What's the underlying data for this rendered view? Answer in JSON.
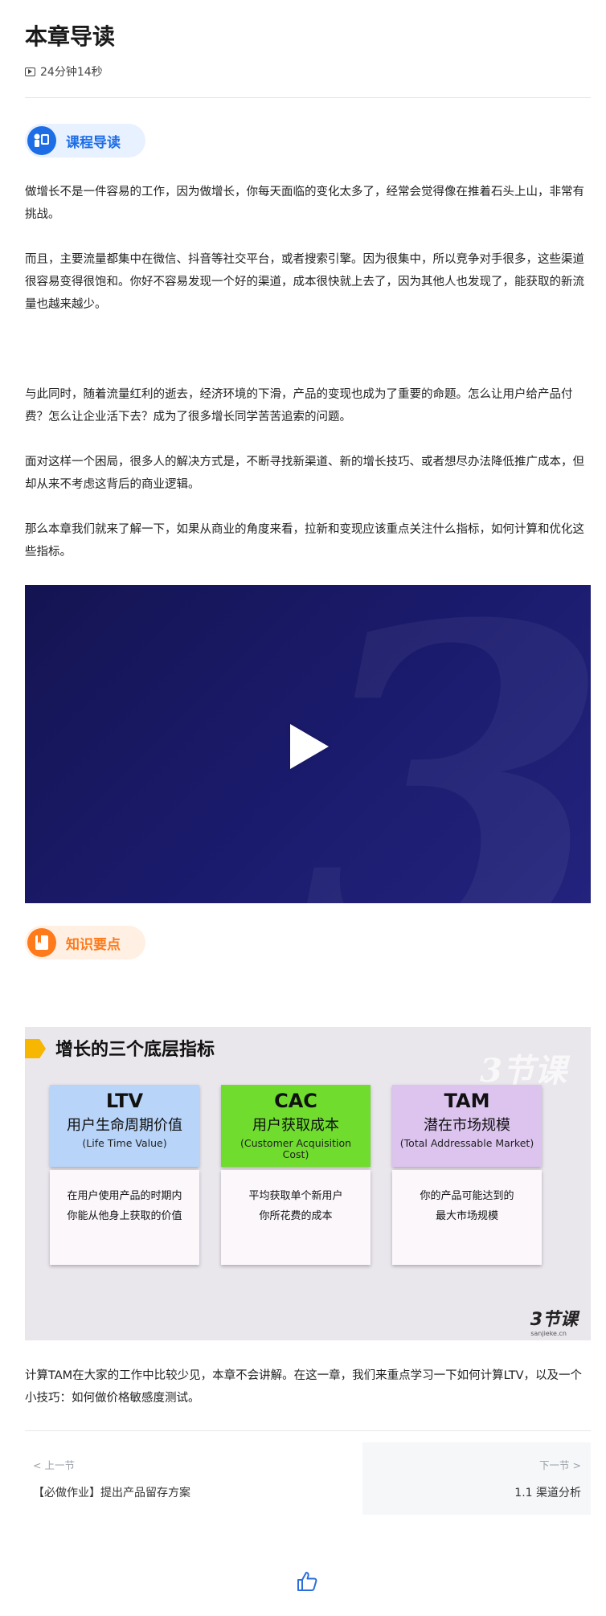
{
  "header": {
    "title": "本章导读",
    "duration": "24分钟14秒"
  },
  "section_intro": {
    "label": "课程导读"
  },
  "paragraphs": {
    "p1": "做增长不是一件容易的工作，因为做增长，你每天面临的变化太多了，经常会觉得像在推着石头上山，非常有挑战。",
    "p2": "而且，主要流量都集中在微信、抖音等社交平台，或者搜索引擎。因为很集中，所以竞争对手很多，这些渠道很容易变得很饱和。你好不容易发现一个好的渠道，成本很快就上去了，因为其他人也发现了，能获取的新流量也越来越少。",
    "p3": "与此同时，随着流量红利的逝去，经济环境的下滑，产品的变现也成为了重要的命题。怎么让用户给产品付费？怎么让企业活下去？成为了很多增长同学苦苦追索的问题。",
    "p4": "面对这样一个困局，很多人的解决方式是，不断寻找新渠道、新的增长技巧、或者想尽办法降低推广成本，但却从来不考虑这背后的商业逻辑。",
    "p5": "那么本章我们就来了解一下，如果从商业的角度来看，拉新和变现应该重点关注什么指标，如何计算和优化这些指标。",
    "p6": "计算TAM在大家的工作中比较少见，本章不会讲解。在这一章，我们来重点学习一下如何计算LTV，以及一个小技巧：如何做价格敏感度测试。"
  },
  "section_points": {
    "label": "知识要点"
  },
  "slide": {
    "title": "增长的三个底层指标",
    "watermark": "3节课",
    "brand": "3节课",
    "brand_sub": "sanjieke.cn",
    "cards": [
      {
        "abbr": "LTV",
        "cn": "用户生命周期价值",
        "en": "(Life Time Value)",
        "desc1": "在用户使用产品的时期内",
        "desc2": "你能从他身上获取的价值",
        "color": "#b8d4f8"
      },
      {
        "abbr": "CAC",
        "cn": "用户获取成本",
        "en": "(Customer Acquisition Cost)",
        "desc1": "平均获取单个新用户",
        "desc2": "你所花费的成本",
        "color": "#6fdc2e"
      },
      {
        "abbr": "TAM",
        "cn": "潜在市场规模",
        "en": "(Total Addressable Market)",
        "desc1": "你的产品可能达到的",
        "desc2": "最大市场规模",
        "color": "#dcc4ee"
      }
    ]
  },
  "nav": {
    "prev_label": "< 上一节",
    "prev_title": "【必做作业】提出产品留存方案",
    "next_label": "下一节 >",
    "next_title": "1.1 渠道分析"
  },
  "colors": {
    "accent_blue": "#1d6de6",
    "accent_orange": "#ff7a1a",
    "video_bg": "#1b1b6e"
  }
}
